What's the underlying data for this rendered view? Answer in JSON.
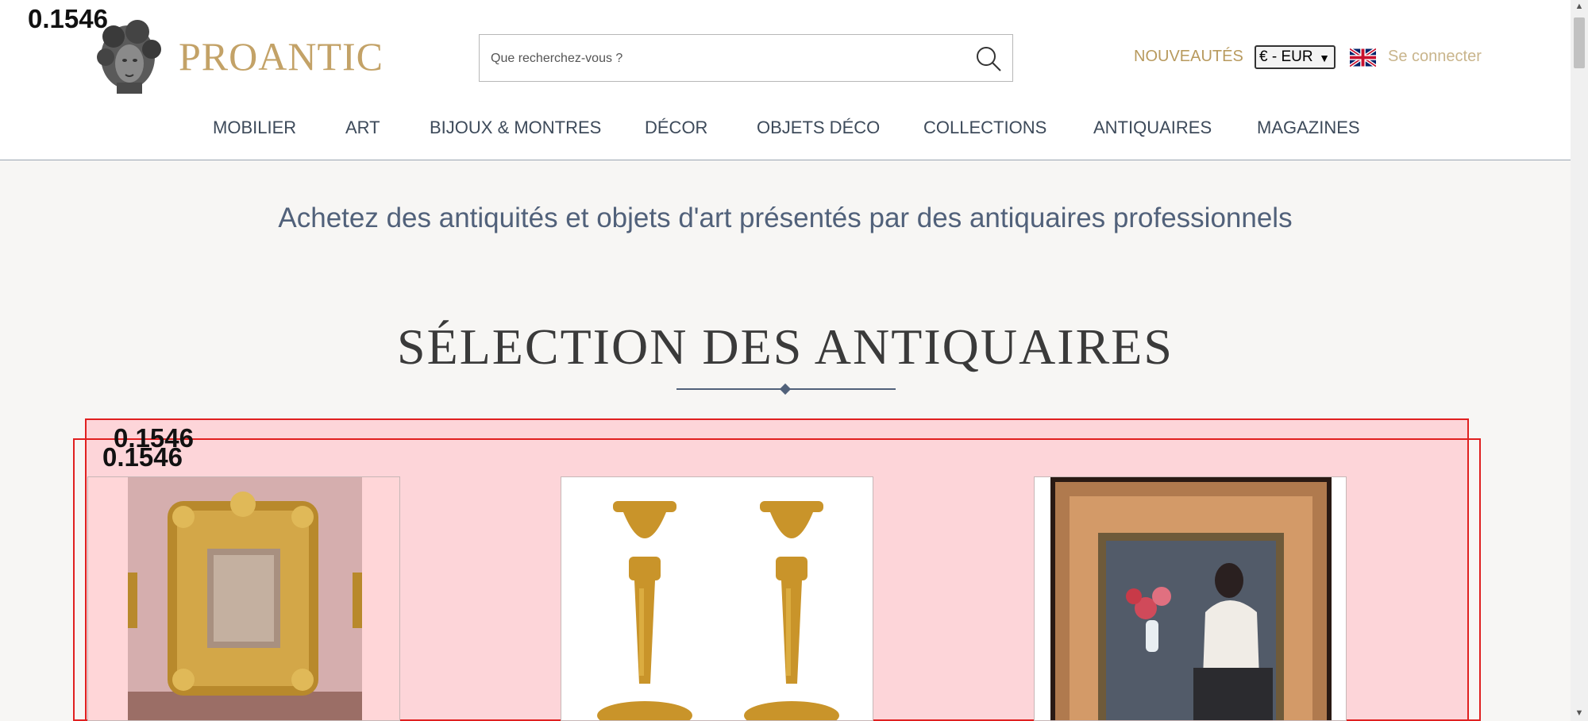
{
  "overlay_labels": {
    "top_left": "0.1546",
    "cards_box_a": "0.1546",
    "cards_box_b": "0.1546"
  },
  "header": {
    "logo_text": "PROANTIC",
    "search_placeholder": "Que recherchez-vous ?",
    "new_label": "NOUVEAUTÉS",
    "currency": "€ - EUR",
    "login_label": "Se connecter",
    "language_flag": "uk-flag-icon"
  },
  "nav": {
    "items": [
      {
        "label": "MOBILIER"
      },
      {
        "label": "ART"
      },
      {
        "label": "BIJOUX & MONTRES"
      },
      {
        "label": "DÉCOR"
      },
      {
        "label": "OBJETS DÉCO"
      },
      {
        "label": "COLLECTIONS"
      },
      {
        "label": "ANTIQUAIRES"
      },
      {
        "label": "MAGAZINES"
      }
    ]
  },
  "main": {
    "tagline": "Achetez des antiquités et objets d'art présentés par des antiquaires professionnels",
    "section_title": "SÉLECTION DES ANTIQUAIRES"
  },
  "colors": {
    "brand_gold": "#c3a267",
    "nav_text": "#3d4a5a",
    "tagline_blue": "#51617a",
    "highlight_red": "#e02020"
  }
}
